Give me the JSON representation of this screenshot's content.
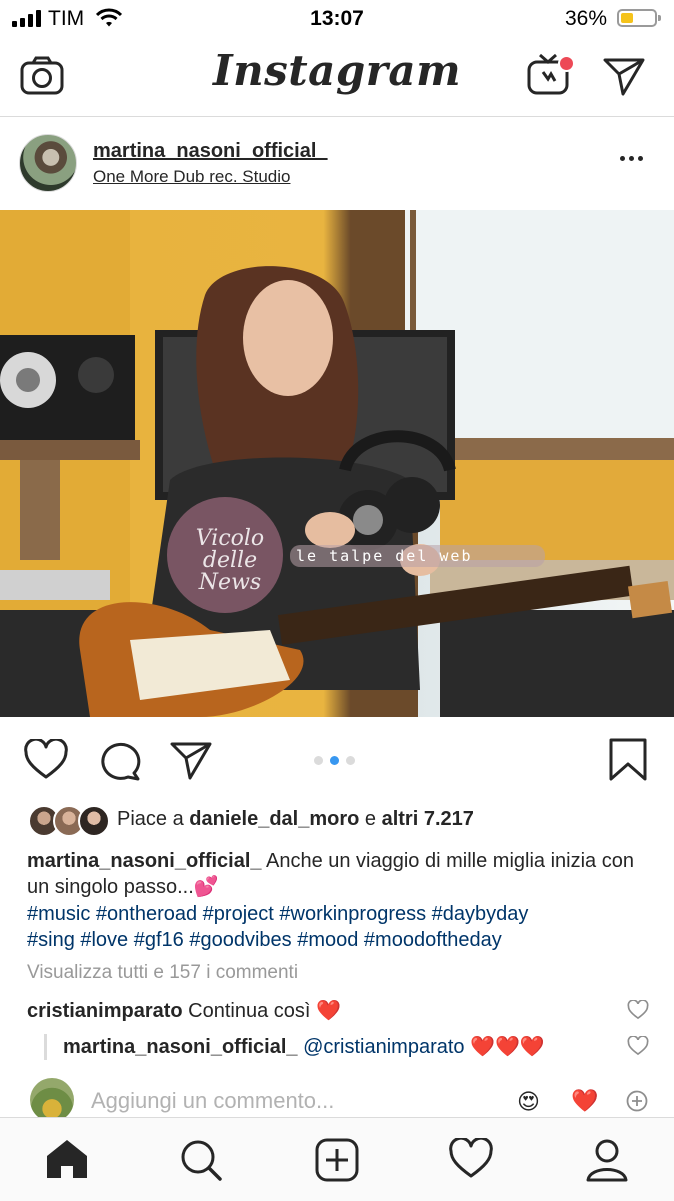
{
  "status_bar": {
    "carrier": "TIM",
    "time": "13:07",
    "battery_percent": "36%",
    "battery_level": 0.36
  },
  "header": {
    "app_title": "Instagram",
    "icons": [
      "camera-icon",
      "igtv-icon",
      "direct-message-icon"
    ]
  },
  "post": {
    "username": "martina_nasoni_official_",
    "location": "One More Dub rec. Studio",
    "carousel": {
      "count": 3,
      "active_index": 1
    },
    "likes": {
      "prefix": "Piace a",
      "first_liker": "daniele_dal_moro",
      "conjunction": "e",
      "others": "altri 7.217"
    },
    "caption": {
      "author": "martina_nasoni_official_",
      "text": " Anche un viaggio di mille miglia inizia con un singolo passo...💕",
      "hashtags_line1": "#music #ontheroad #project #workinprogress #daybyday",
      "hashtags_line2": "#sing #love #gf16 #goodvibes #mood #moodoftheday"
    },
    "view_all_comments": "Visualizza tutti e 157 i commenti",
    "comments": [
      {
        "author": "cristianimparato",
        "text": " Continua così ",
        "emoji": "❤️"
      },
      {
        "author": "martina_nasoni_official_",
        "mention": " @cristianimparato",
        "emoji": " ❤️❤️❤️"
      }
    ],
    "add_comment_placeholder": "Aggiungi un commento...",
    "quick_reactions": [
      "😍",
      "❤️"
    ]
  },
  "photo_watermark": {
    "text_script": "Vicolo delle News",
    "text_banner": "le talpe del web"
  },
  "tab_bar": {
    "items": [
      "home-icon",
      "search-icon",
      "new-post-icon",
      "activity-icon",
      "profile-icon"
    ],
    "active": "home-icon"
  },
  "colors": {
    "link": "#003569",
    "accent_blue": "#3897f0",
    "notification_red": "#ed4956",
    "muted_grey": "#999999"
  }
}
